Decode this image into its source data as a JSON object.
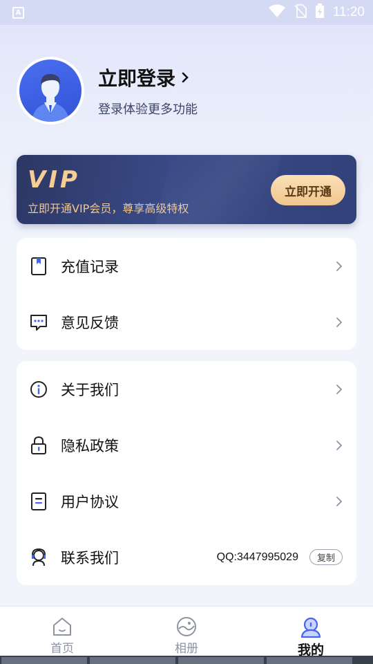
{
  "status_bar": {
    "time": "11:20"
  },
  "profile": {
    "title": "立即登录",
    "subtitle": "登录体验更多功能"
  },
  "vip": {
    "logo": "VIP",
    "description": "立即开通VIP会员，尊享高级特权",
    "button_label": "立即开通"
  },
  "menu_group_1": [
    {
      "label": "充值记录",
      "icon": "recharge-book-icon"
    },
    {
      "label": "意见反馈",
      "icon": "feedback-chat-icon"
    }
  ],
  "menu_group_2": [
    {
      "label": "关于我们",
      "icon": "info-icon"
    },
    {
      "label": "隐私政策",
      "icon": "lock-icon"
    },
    {
      "label": "用户协议",
      "icon": "document-icon"
    },
    {
      "label": "联系我们",
      "icon": "customer-service-icon",
      "value": "QQ:3447995029",
      "action": "复制"
    }
  ],
  "bottom_nav": [
    {
      "label": "首页",
      "icon": "home-icon",
      "active": false
    },
    {
      "label": "相册",
      "icon": "album-icon",
      "active": false
    },
    {
      "label": "我的",
      "icon": "profile-icon",
      "active": true
    }
  ],
  "colors": {
    "accent": "#4466ee",
    "vip_gold": "#f3cf96",
    "vip_card_bg": "#33417a"
  }
}
